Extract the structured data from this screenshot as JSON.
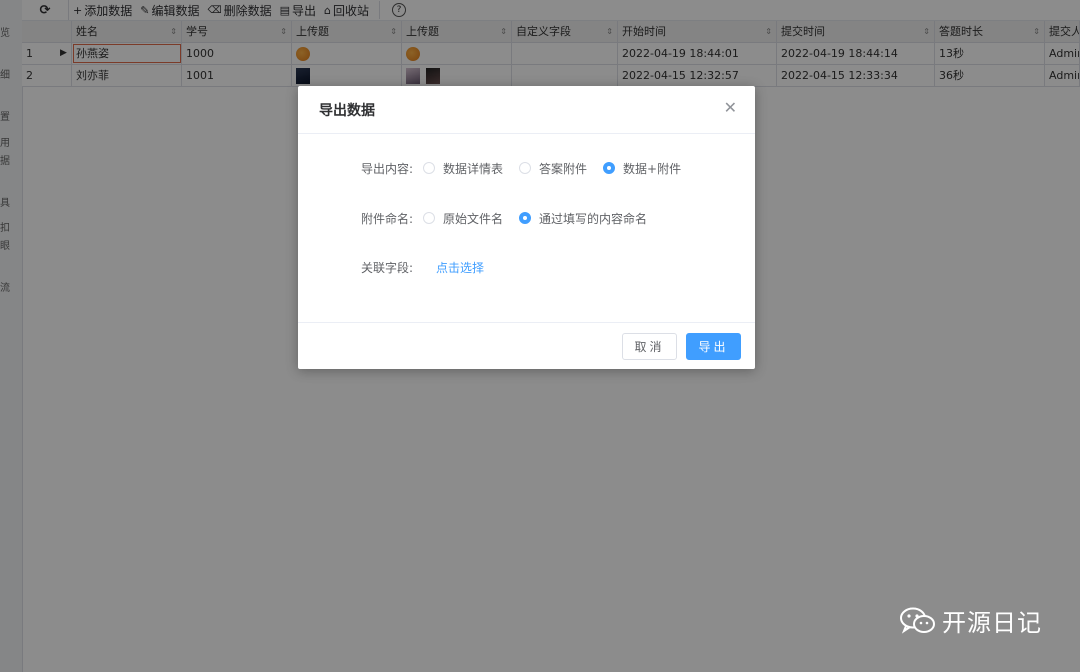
{
  "sidebar": {
    "labels": [
      "览",
      "细",
      "置",
      "用",
      "据",
      "具",
      "扣",
      "眼",
      "流"
    ]
  },
  "toolbar": {
    "refresh_icon": "refresh-icon",
    "buttons": [
      {
        "icon": "plus-icon",
        "glyph": "+",
        "label": "添加数据"
      },
      {
        "icon": "pencil-icon",
        "glyph": "✎",
        "label": "编辑数据"
      },
      {
        "icon": "trash-icon",
        "glyph": "🗑",
        "label": "删除数据"
      },
      {
        "icon": "export-icon",
        "glyph": "▤",
        "label": "导出"
      },
      {
        "icon": "recycle-bin-icon",
        "glyph": "♻",
        "label": "回收站"
      }
    ],
    "help_glyph": "?"
  },
  "grid": {
    "headers": [
      "姓名",
      "学号",
      "上传题",
      "上传题",
      "自定义字段",
      "开始时间",
      "提交时间",
      "答题时长",
      "提交人"
    ],
    "rows": [
      {
        "index": "1",
        "name": "孙燕姿",
        "id": "1000",
        "start": "2022-04-19 18:44:01",
        "submit": "2022-04-19 18:44:14",
        "duration": "13秒",
        "submitter": "Admin"
      },
      {
        "index": "2",
        "name": "刘亦菲",
        "id": "1001",
        "start": "2022-04-15 12:32:57",
        "submit": "2022-04-15 12:33:34",
        "duration": "36秒",
        "submitter": "Admin"
      }
    ]
  },
  "dialog": {
    "title": "导出数据",
    "close_glyph": "✕",
    "export_content": {
      "label": "导出内容:",
      "options": [
        "数据详情表",
        "答案附件",
        "数据+附件"
      ],
      "selected": 2
    },
    "attachment_naming": {
      "label": "附件命名:",
      "options": [
        "原始文件名",
        "通过填写的内容命名"
      ],
      "selected": 1
    },
    "related_fields": {
      "label": "关联字段:",
      "link": "点击选择"
    },
    "cancel_label": "取消",
    "export_label": "导出"
  },
  "brand": {
    "name": "开源日记"
  },
  "colors": {
    "primary": "#409eff",
    "overlay": "rgba(0,0,0,0.45)",
    "selected_cell_border": "#e06c4c"
  }
}
